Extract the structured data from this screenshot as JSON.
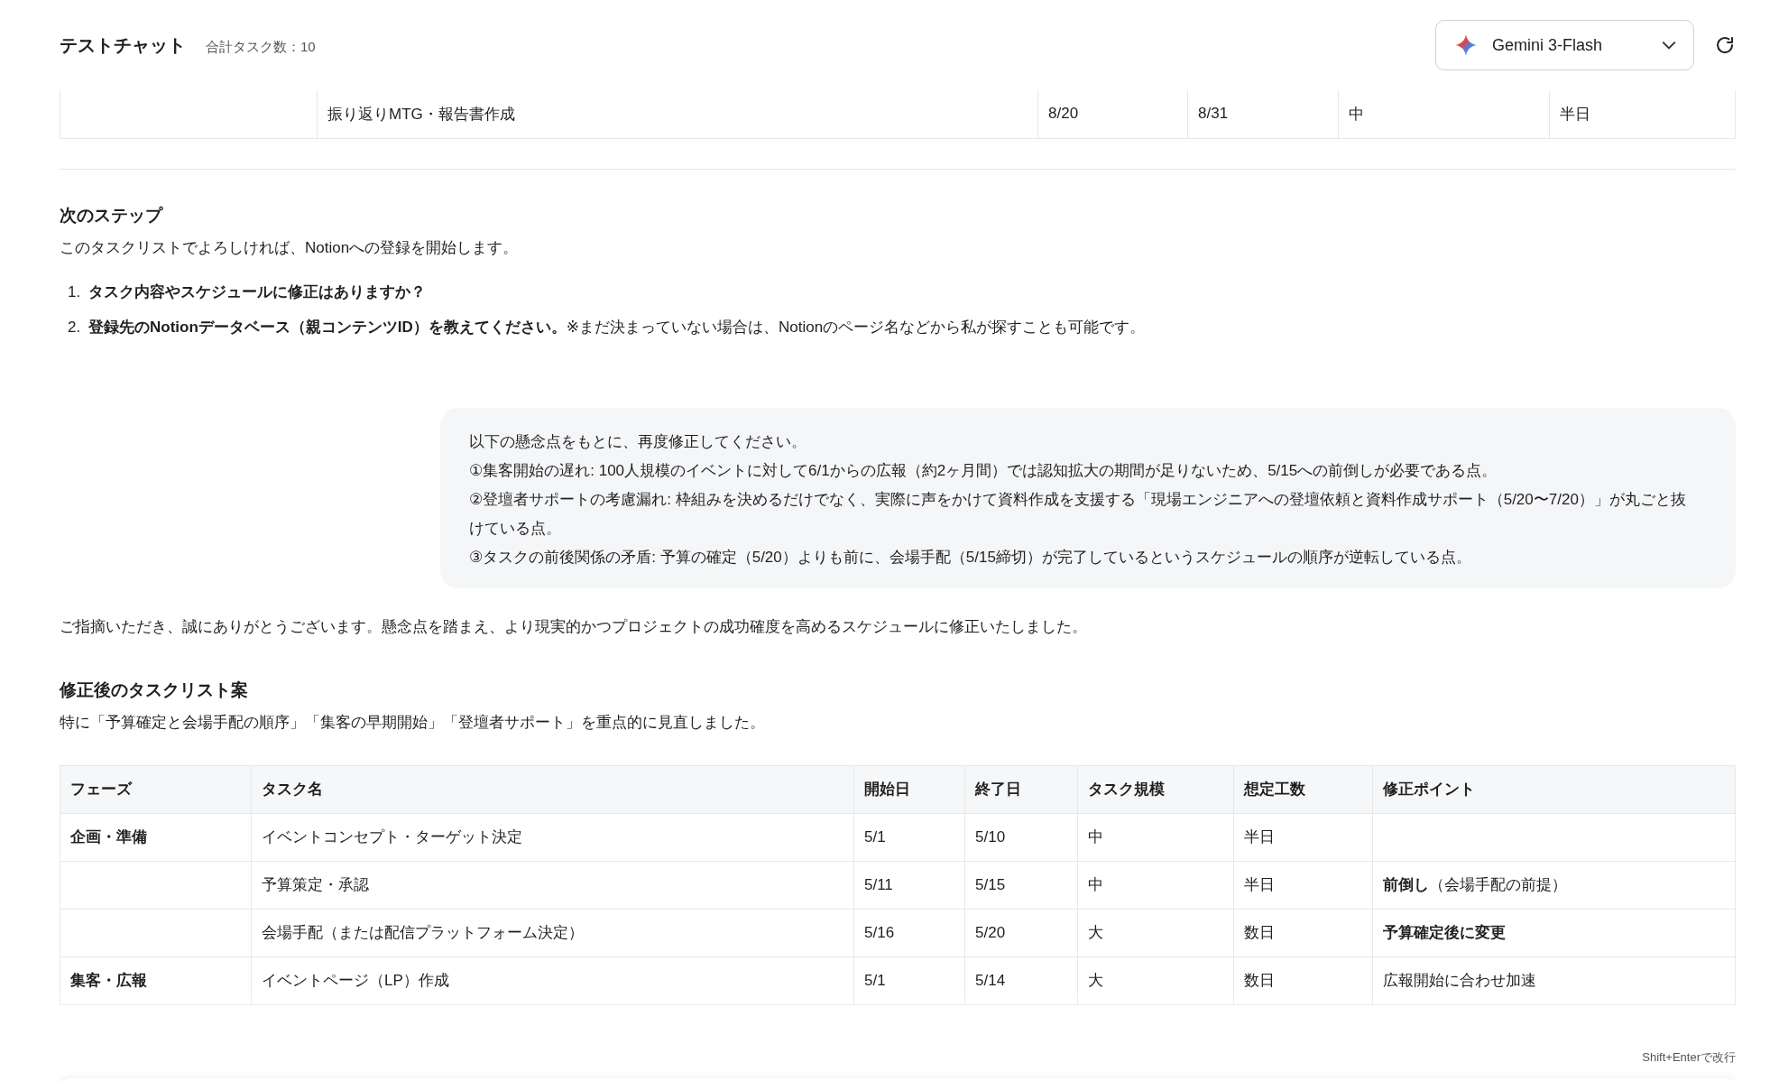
{
  "header": {
    "title": "テストチャット",
    "task_count": "合計タスク数：10",
    "model": "Gemini 3-Flash"
  },
  "prev_table": {
    "rows": [
      {
        "cells": [
          "",
          "振り返りMTG・報告書作成",
          "8/20",
          "8/31",
          "中",
          "半日"
        ]
      }
    ]
  },
  "assistant_1": {
    "heading": "次のステップ",
    "intro": "このタスクリストでよろしければ、Notionへの登録を開始します。",
    "items": [
      {
        "marker": "1.",
        "text": "**タスク内容やスケジュールに修正はありますか？**"
      },
      {
        "marker": "2.",
        "text": "**登録先のNotionデータベース（親コンテンツID）を教えてください。**※まだ決まっていない場合は、Notionのページ名などから私が探すことも可能です。"
      }
    ]
  },
  "user_message": {
    "lines": [
      "以下の懸念点をもとに、再度修正してください。",
      "①集客開始の遅れ: 100人規模のイベントに対して6/1からの広報（約2ヶ月間）では認知拡大の期間が足りないため、5/15への前倒しが必要である点。",
      "②登壇者サポートの考慮漏れ: 枠組みを決めるだけでなく、実際に声をかけて資料作成を支援する「現場エンジニアへの登壇依頼と資料作成サポート（5/20〜7/20）」が丸ごと抜けている点。",
      "③タスクの前後関係の矛盾: 予算の確定（5/20）よりも前に、会場手配（5/15締切）が完了しているというスケジュールの順序が逆転している点。"
    ]
  },
  "assistant_2": {
    "intro": "ご指摘いただき、誠にありがとうございます。懸念点を踏まえ、より現実的かつプロジェクトの成功確度を高めるスケジュールに修正いたしました。",
    "heading": "修正後のタスクリスト案",
    "lead": "特に「予算確定と会場手配の順序」「集客の早期開始」「登壇者サポート」を重点的に見直しました。",
    "table": {
      "columns": [
        "フェーズ",
        "タスク名",
        "開始日",
        "終了日",
        "タスク規模",
        "想定工数",
        "修正ポイント"
      ],
      "rows": [
        {
          "phase": "企画・準備",
          "task": "イベントコンセプト・ターゲット決定",
          "start": "5/1",
          "end": "5/10",
          "size": "中",
          "effort": "半日"
        },
        {
          "phase": "",
          "task": "予算策定・承認",
          "start": "5/11",
          "end": "5/15",
          "size": "中",
          "effort": "半日",
          "point": "**前倒し**（会場手配の前提）",
          "point_bold": false
        },
        {
          "phase": "",
          "task": "会場手配（または配信プラットフォーム決定）",
          "start": "5/16",
          "end": "5/20",
          "size": "大",
          "effort": "数日",
          "point": "予算確定後に変更",
          "point_bold": true
        },
        {
          "phase": "集客・広報",
          "task": "イベントページ（LP）作成",
          "start": "5/1",
          "end": "5/14",
          "size": "大",
          "effort": "数日",
          "point": "広報開始に合わせ加速",
          "point_bold": false
        }
      ]
    }
  },
  "composer": {
    "hint": "Shift+Enterで改行"
  }
}
